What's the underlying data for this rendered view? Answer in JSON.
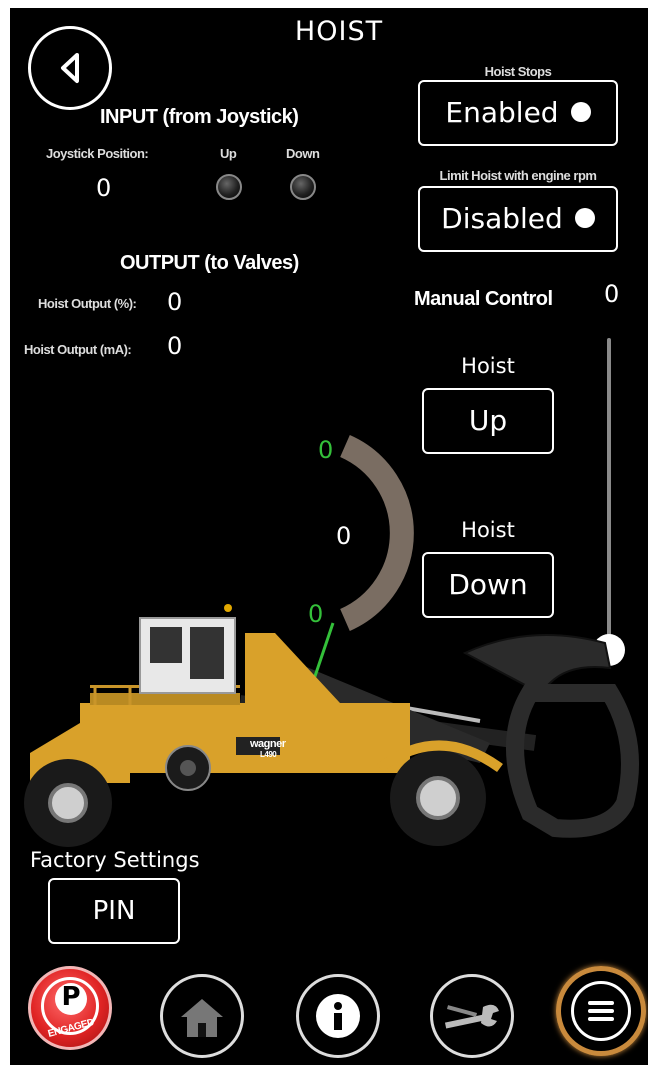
{
  "header": {
    "title": "HOIST"
  },
  "input": {
    "title": "INPUT (from Joystick)",
    "joystick_label": "Joystick Position:",
    "joystick_value": "0",
    "up_label": "Up",
    "down_label": "Down"
  },
  "output": {
    "title": "OUTPUT (to Valves)",
    "pct_label": "Hoist Output (%):",
    "pct_value": "0",
    "ma_label": "Hoist Output (mA):",
    "ma_value": "0"
  },
  "hoist_stops": {
    "label": "Hoist Stops",
    "value": "Enabled"
  },
  "limit_rpm": {
    "label": "Limit Hoist with engine rpm",
    "value": "Disabled"
  },
  "manual": {
    "label": "Manual Control",
    "value": "0",
    "slider_level": 0
  },
  "hoist_up": {
    "label": "Hoist",
    "button": "Up"
  },
  "hoist_down": {
    "label": "Hoist",
    "button": "Down"
  },
  "gauge": {
    "top": "0",
    "center": "0",
    "bottom": "0"
  },
  "vehicle": {
    "brand": "wagner",
    "model": "L490"
  },
  "factory": {
    "label": "Factory Settings",
    "button": "PIN"
  },
  "nav": {
    "parking_letter": "P",
    "parking_status": "ENGAGED"
  },
  "colors": {
    "accent_green": "#34c03a",
    "machine_yellow": "#d9a12a",
    "parking_red": "#e02424",
    "menu_ring": "#c98a3c"
  }
}
